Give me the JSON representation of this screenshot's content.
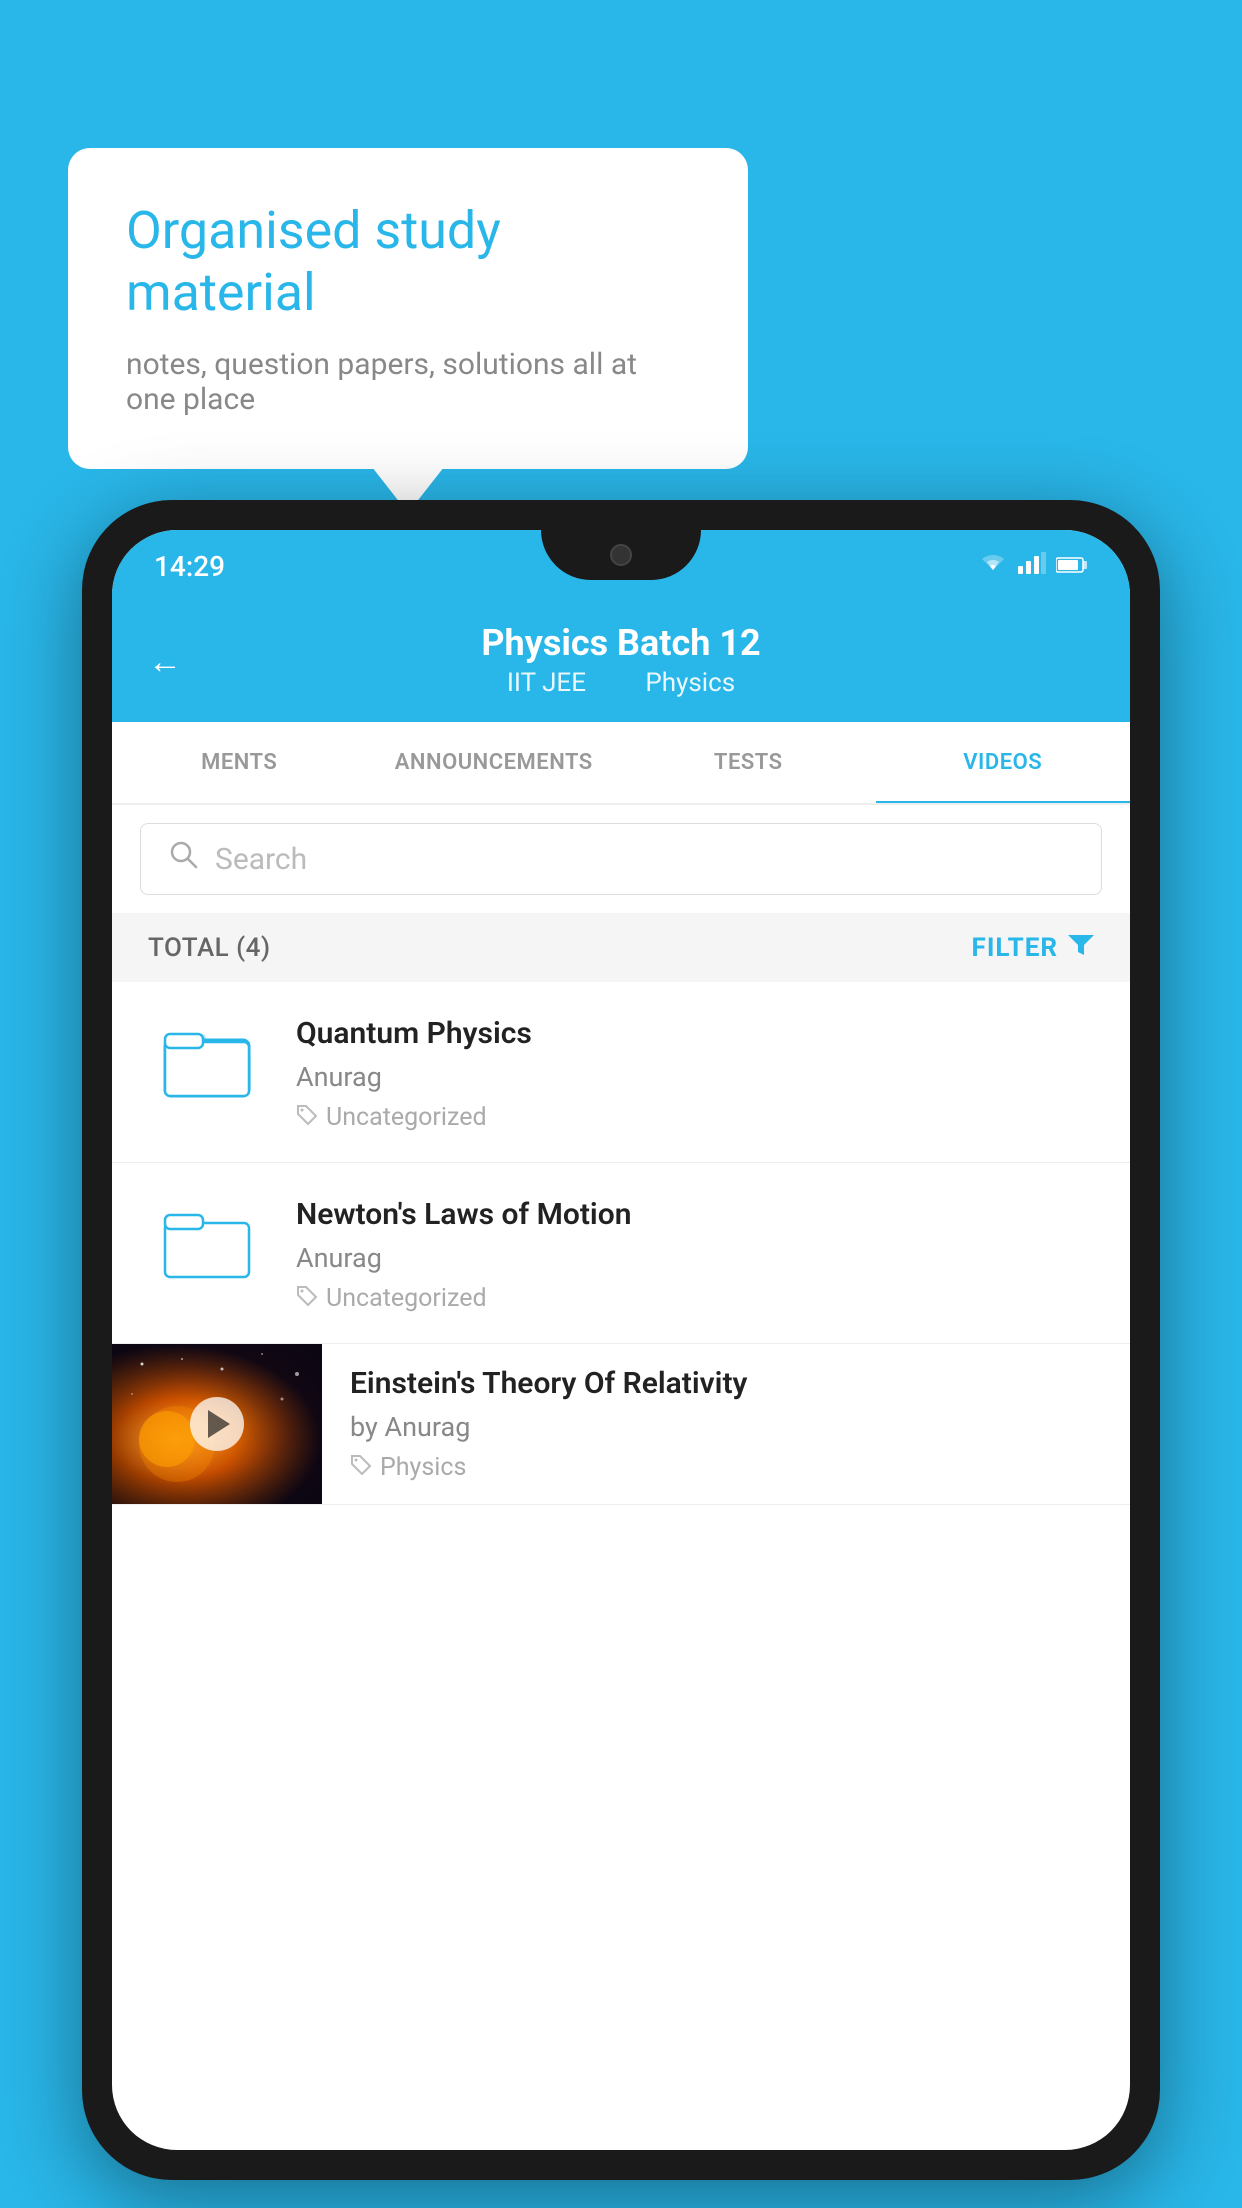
{
  "background_color": "#29b6e8",
  "speech_bubble": {
    "title": "Organised study material",
    "subtitle": "notes, question papers, solutions all at one place"
  },
  "status_bar": {
    "time": "14:29",
    "wifi": "▼",
    "signal": "▲",
    "battery": "▮"
  },
  "app_header": {
    "back_label": "←",
    "title": "Physics Batch 12",
    "subtitle_course": "IIT JEE",
    "subtitle_subject": "Physics"
  },
  "tabs": [
    {
      "label": "MENTS",
      "active": false
    },
    {
      "label": "ANNOUNCEMENTS",
      "active": false
    },
    {
      "label": "TESTS",
      "active": false
    },
    {
      "label": "VIDEOS",
      "active": true
    }
  ],
  "search": {
    "placeholder": "Search"
  },
  "filter_bar": {
    "total_label": "TOTAL (4)",
    "filter_label": "FILTER"
  },
  "videos": [
    {
      "title": "Quantum Physics",
      "author": "Anurag",
      "tag": "Uncategorized",
      "type": "folder"
    },
    {
      "title": "Newton's Laws of Motion",
      "author": "Anurag",
      "tag": "Uncategorized",
      "type": "folder"
    },
    {
      "title": "Einstein's Theory Of Relativity",
      "author": "by Anurag",
      "tag": "Physics",
      "type": "video"
    }
  ]
}
